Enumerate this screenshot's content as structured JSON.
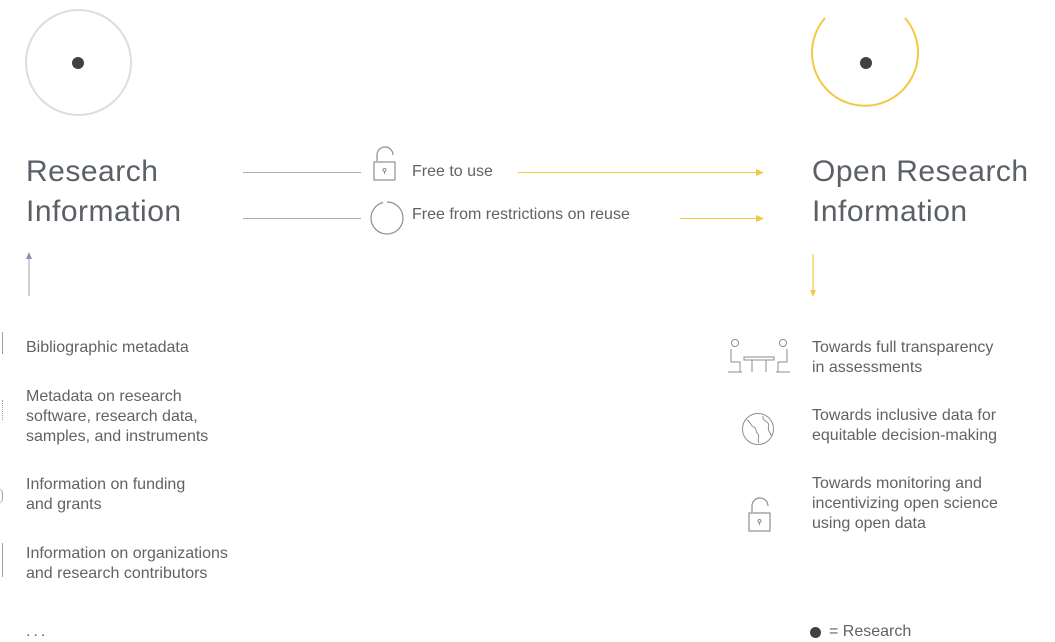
{
  "left": {
    "title": "Research\nInformation",
    "items": [
      "Bibliographic metadata",
      "Metadata on research\nsoftware, research data,\nsamples, and instruments",
      "Information on funding\nand grants",
      "Information on organizations\nand research contributors"
    ],
    "ellipsis": "...",
    "icons": [
      "bracket-icon",
      "bracket-icon",
      "bracket-icon",
      "bracket-icon"
    ],
    "circle_color": "#dcdde3",
    "line_color": "#b9a7b3"
  },
  "middle": {
    "rows": [
      {
        "label": "Free to use",
        "icon": "unlocked-padlock-icon"
      },
      {
        "label": "Free from restrictions on reuse",
        "icon": "refresh-cycle-icon"
      }
    ]
  },
  "right": {
    "title": "Open Research\nInformation",
    "items": [
      {
        "text": "Towards full transparency\nin assessments",
        "icon": "meeting-table-icon"
      },
      {
        "text": "Towards inclusive data for\nequitable decision-making",
        "icon": "globe-icon"
      },
      {
        "text": "Towards monitoring and\nincentivizing open science\nusing open data",
        "icon": "padlock-icon"
      }
    ],
    "circle_color": "#f5c842",
    "line_color": "#f5c842"
  },
  "legend": {
    "text": "= Research"
  },
  "colors": {
    "dot": "#3e4247",
    "gray": "#5f6368",
    "yellow": "#f5c842"
  }
}
